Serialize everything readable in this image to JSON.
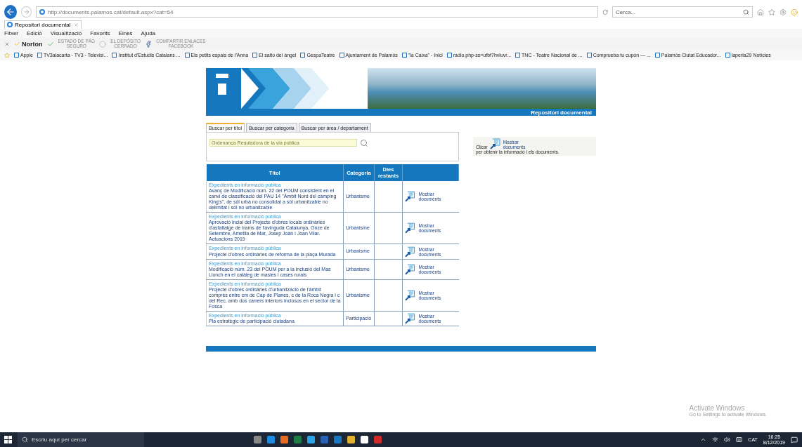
{
  "browser": {
    "url": "http://documents.palamos.cat/default.aspx?cat=54",
    "search_placeholder": "Cerca...",
    "tab_title": "Repositori documental",
    "menu": [
      "Fitxer",
      "Edició",
      "Visualització",
      "Favorits",
      "Eines",
      "Ajuda"
    ],
    "toolbar": {
      "brand": "Norton",
      "items": [
        {
          "top": "ESTADO DE PÁG",
          "bottom": "SEGURO"
        },
        {
          "top": "EL DEPÓSITO",
          "bottom": "CERRADO"
        },
        {
          "top": "COMPARTIR ENLACES",
          "bottom": "FACEBOOK"
        }
      ]
    },
    "bookmarks": [
      "Apple",
      "TV3alacarta - TV3 - Televisi...",
      "Institut d'Estudis Catalans ...",
      "Els petits espais de l'Anna",
      "El salto del ángel",
      "GespaTeatre",
      "Ajuntament de Palamós",
      "\"la Caixa\" - Inici",
      "radio.php-ss=ufbf7hvluvr...",
      "TNC - Teatre Nacional de ...",
      "Comprueba tu cupón — ...",
      "Palamós Ciutat Educador...",
      "laperla29  Notícies"
    ]
  },
  "page": {
    "banner_title": "Repositori documental",
    "tabs": [
      {
        "label": "Buscar per títol",
        "selected": true
      },
      {
        "label": "Buscar per categoria",
        "selected": false
      },
      {
        "label": "Buscar per àrea / departament",
        "selected": false
      }
    ],
    "search": {
      "value": "Ordenança Reguladora de la via pública"
    },
    "table": {
      "columns": [
        "Títol",
        "Categoria",
        "Dies restants"
      ],
      "rows": [
        {
          "type": "Expedients en informació pública",
          "title": "Avanç de Modificació núm. 22 del POUM consistent en el canvi de classificació del PAU 14 \"Àmbit Nord del càmping King's\", de sòl urbà no consolidat a sòl urbanitzable no delimitat i sòl no urbanitzable",
          "category": "Urbanisme",
          "action": "Mostrar documents"
        },
        {
          "type": "Expedients en informació pública",
          "title": "Aprovació incial del Projecte d'obres locals ordinàries d'asfaltatge de trams de l'avinguda Catalunya, Onze de Setembre, Ametlla de Mar, Josep Joan i Joan Vilar. Actuacions 2019",
          "category": "Urbanisme",
          "action": "Mostrar documents"
        },
        {
          "type": "Expedients en informació pública",
          "title": "Projecte d'obres ordinàries de reforma de la plaça Murada",
          "category": "Urbanisme",
          "action": "Mostrar documents"
        },
        {
          "type": "Expedients en informació pública",
          "title": "Modificació núm. 23 del POUM per a la inclusió del Mas Llonch en el catàleg de masies i cases rurals",
          "category": "Urbanisme",
          "action": "Mostrar documents"
        },
        {
          "type": "Expedients en informació pública",
          "title": "Projecte d'obres ordinàries d'urbanització de l'àmbit comprès entre cm de Cap de Planes, c de la Roca Negra i c del Rec, amb dos carrers interiors inclosos en el sector de la Fosca",
          "category": "Urbanisme",
          "action": "Mostrar documents"
        },
        {
          "type": "Expedients en informació pública",
          "title": "Pla estratègic de participació ciutadana",
          "category": "Participació",
          "action": "Mostrar documents"
        }
      ]
    },
    "hint": {
      "prefix": "Clicar",
      "action": "Mostrar documents",
      "text": "per obtenir la informació i els documents."
    }
  },
  "activation": {
    "title": "Activate Windows",
    "subtitle": "Go to Settings to activate Windows."
  },
  "taskbar": {
    "search_placeholder": "Escriu aquí per cercar",
    "language": "CAT",
    "time": "16:25",
    "date": "8/12/2019"
  }
}
